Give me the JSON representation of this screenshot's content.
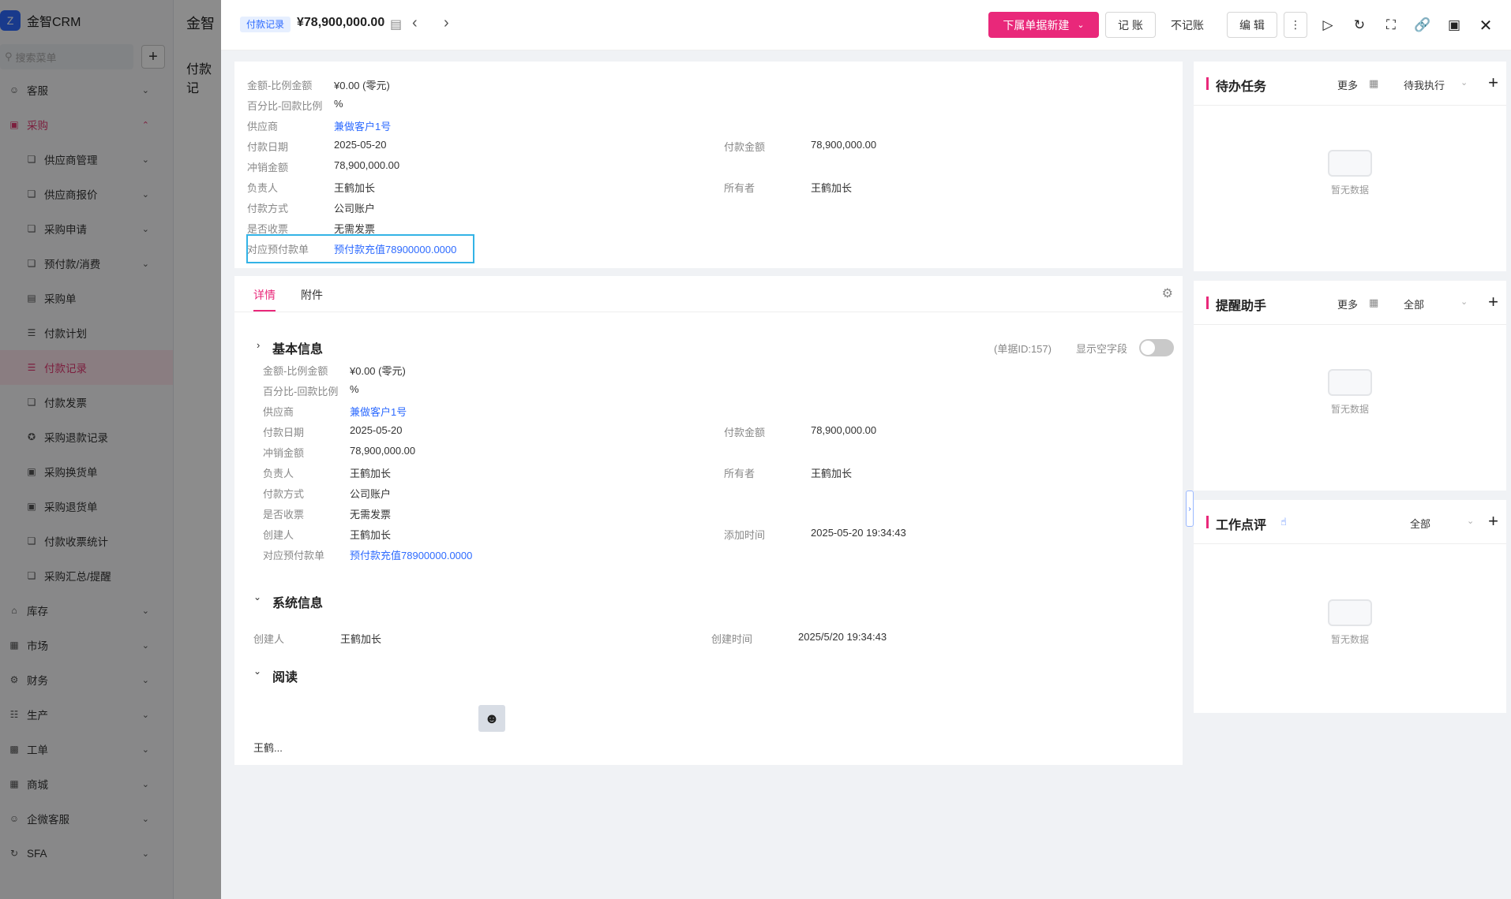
{
  "app": {
    "logo_text": "金智CRM",
    "search_placeholder": "搜索菜单",
    "mid_title": "金智",
    "mid_subtitle": "付款记"
  },
  "sidebar": {
    "items": [
      {
        "label": "客服",
        "icon": "headset-icon"
      },
      {
        "label": "采购",
        "icon": "cart-icon"
      },
      {
        "label": "供应商管理"
      },
      {
        "label": "供应商报价"
      },
      {
        "label": "采购申请"
      },
      {
        "label": "预付款/消费"
      },
      {
        "label": "采购单"
      },
      {
        "label": "付款计划"
      },
      {
        "label": "付款记录"
      },
      {
        "label": "付款发票"
      },
      {
        "label": "采购退款记录"
      },
      {
        "label": "采购换货单"
      },
      {
        "label": "采购退货单"
      },
      {
        "label": "付款收票统计"
      },
      {
        "label": "采购汇总/提醒"
      },
      {
        "label": "库存"
      },
      {
        "label": "市场"
      },
      {
        "label": "财务"
      },
      {
        "label": "生产"
      },
      {
        "label": "工单"
      },
      {
        "label": "商城"
      },
      {
        "label": "企微客服"
      },
      {
        "label": "SFA"
      }
    ]
  },
  "topbar": {
    "tag": "付款记录",
    "amount": "¥78,900,000.00",
    "primary_btn": "下属单据新建",
    "btn_record": "记 账",
    "btn_norecord": "不记账",
    "btn_edit": "编 辑"
  },
  "summary": {
    "fields": [
      {
        "label": "金额-比例金额",
        "value": "¥0.00 (零元)"
      },
      {
        "label": "百分比-回款比例",
        "value": "%"
      },
      {
        "label": "供应商",
        "value": "兼做客户1号"
      },
      {
        "label": "付款日期",
        "value": "2025-05-20"
      },
      {
        "label": "冲销金额",
        "value": "78,900,000.00"
      },
      {
        "label": "负责人",
        "value": "王鹤加长"
      },
      {
        "label": "付款方式",
        "value": "公司账户"
      },
      {
        "label": "是否收票",
        "value": "无需发票"
      },
      {
        "label": "对应预付款单",
        "value": "预付款充值78900000.0000"
      }
    ],
    "right_fields": [
      {
        "label": "付款金额",
        "value": "78,900,000.00"
      },
      {
        "label": "所有者",
        "value": "王鹤加长"
      }
    ]
  },
  "detail": {
    "tabs": [
      "详情",
      "附件"
    ],
    "basic_title": "基本信息",
    "doc_id": "(单据ID:157)",
    "show_empty": "显示空字段",
    "fields": [
      {
        "label": "金额-比例金额",
        "value": "¥0.00 (零元)"
      },
      {
        "label": "百分比-回款比例",
        "value": "%"
      },
      {
        "label": "供应商",
        "value": "兼做客户1号"
      },
      {
        "label": "付款日期",
        "value": "2025-05-20"
      },
      {
        "label": "冲销金额",
        "value": "78,900,000.00"
      },
      {
        "label": "负责人",
        "value": "王鹤加长"
      },
      {
        "label": "付款方式",
        "value": "公司账户"
      },
      {
        "label": "是否收票",
        "value": "无需发票"
      },
      {
        "label": "创建人",
        "value": "王鹤加长"
      },
      {
        "label": "对应预付款单",
        "value": "预付款充值78900000.0000"
      }
    ],
    "right_fields": [
      {
        "label": "付款金额",
        "value": "78,900,000.00"
      },
      {
        "label": "所有者",
        "value": "王鹤加长"
      },
      {
        "label": "添加时间",
        "value": "2025-05-20 19:34:43"
      }
    ],
    "sys_title": "系统信息",
    "sys_fields": [
      {
        "label": "创建人",
        "value": "王鹤加长"
      },
      {
        "label": "创建时间",
        "value": "2025/5/20 19:34:43"
      }
    ],
    "read_title": "阅读",
    "reader_name": "王鹤..."
  },
  "side": {
    "todo": {
      "title": "待办任务",
      "more": "更多",
      "filter": "待我执行",
      "empty": "暂无数据"
    },
    "remind": {
      "title": "提醒助手",
      "more": "更多",
      "filter": "全部",
      "empty": "暂无数据"
    },
    "review": {
      "title": "工作点评",
      "filter": "全部",
      "empty": "暂无数据"
    }
  },
  "colors": {
    "accent": "#e9287a",
    "link": "#2e6bff",
    "highlight": "#33b3e6"
  }
}
